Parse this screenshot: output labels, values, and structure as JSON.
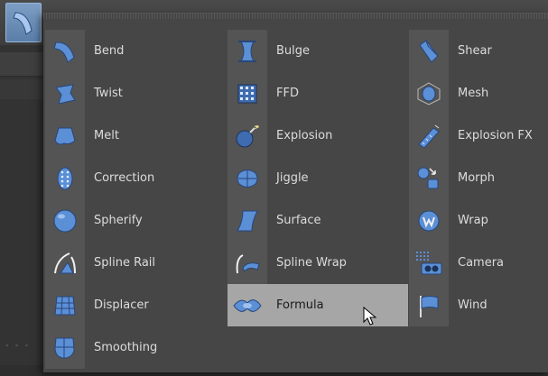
{
  "colors": {
    "accent": "#5b8fd6",
    "hover": "#a6a6a6"
  },
  "menu": {
    "columns": [
      {
        "items": [
          {
            "label": "Bend",
            "icon": "bend-icon"
          },
          {
            "label": "Twist",
            "icon": "twist-icon"
          },
          {
            "label": "Melt",
            "icon": "melt-icon"
          },
          {
            "label": "Correction",
            "icon": "correction-icon"
          },
          {
            "label": "Spherify",
            "icon": "spherify-icon"
          },
          {
            "label": "Spline Rail",
            "icon": "spline-rail-icon"
          },
          {
            "label": "Displacer",
            "icon": "displacer-icon"
          },
          {
            "label": "Smoothing",
            "icon": "smoothing-icon"
          }
        ]
      },
      {
        "items": [
          {
            "label": "Bulge",
            "icon": "bulge-icon"
          },
          {
            "label": "FFD",
            "icon": "ffd-icon"
          },
          {
            "label": "Explosion",
            "icon": "explosion-icon"
          },
          {
            "label": "Jiggle",
            "icon": "jiggle-icon"
          },
          {
            "label": "Surface",
            "icon": "surface-icon"
          },
          {
            "label": "Spline Wrap",
            "icon": "spline-wrap-icon"
          },
          {
            "label": "Formula",
            "icon": "formula-icon",
            "hovered": true
          }
        ]
      },
      {
        "items": [
          {
            "label": "Shear",
            "icon": "shear-icon"
          },
          {
            "label": "Mesh",
            "icon": "mesh-icon"
          },
          {
            "label": "Explosion FX",
            "icon": "explosion-fx-icon"
          },
          {
            "label": "Morph",
            "icon": "morph-icon"
          },
          {
            "label": "Wrap",
            "icon": "wrap-icon"
          },
          {
            "label": "Camera",
            "icon": "camera-icon"
          },
          {
            "label": "Wind",
            "icon": "wind-icon"
          }
        ]
      }
    ]
  }
}
